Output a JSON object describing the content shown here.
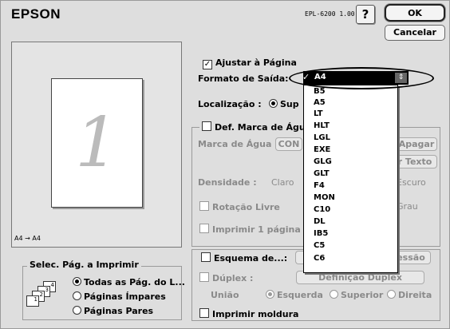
{
  "header": {
    "brand": "EPSON",
    "model": "EPL-6200 1.00",
    "help_label": "?",
    "ok_label": "OK",
    "cancel_label": "Cancelar"
  },
  "preview": {
    "page_number": "1",
    "paper_info": "A4 → A4"
  },
  "print_range": {
    "title": "Selec. Pág. a Imprimir",
    "options": [
      {
        "label": "Todas as Pág. do L...",
        "selected": true
      },
      {
        "label": "Páginas Ímpares",
        "selected": false
      },
      {
        "label": "Páginas Pares",
        "selected": false
      }
    ],
    "icon_pages": [
      "1",
      "2",
      "3",
      "4"
    ]
  },
  "fit_page": {
    "checkbox_label": "Ajustar à Página",
    "checked": true,
    "output_format_label": "Formato de Saída:",
    "selected_format": "A4",
    "location_label": "Localização :",
    "location_value": "Sup"
  },
  "dropdown": {
    "check_glyph": "✓",
    "items": [
      "A4",
      "B5",
      "A5",
      "LT",
      "HLT",
      "LGL",
      "EXE",
      "GLG",
      "GLT",
      "F4",
      "MON",
      "C10",
      "DL",
      "IB5",
      "C5",
      "C6"
    ]
  },
  "watermark": {
    "checkbox_label": "Def. Marca de Águ",
    "watermark_label": "Marca de Água :",
    "watermark_value": "CON",
    "delete_button": "/Apagar",
    "text_button": "r Texto",
    "density_label": "Densidade :",
    "density_light": "Claro",
    "density_dark": "Escuro",
    "rotate_label": "Rotação Livre",
    "degree_label": "Grau",
    "print_first_label": "Imprimir 1 página"
  },
  "layout": {
    "checkbox_label": "Esquema de...:",
    "impression_button": "essão",
    "duplex_label": "Dúplex :",
    "duplex_button": "Definição Dúplex",
    "binding_label": "União",
    "binding_options": [
      {
        "label": "Esquerda",
        "selected": true
      },
      {
        "label": "Superior",
        "selected": false
      },
      {
        "label": "Direita",
        "selected": false
      }
    ],
    "frame_label": "Imprimir moldura"
  }
}
